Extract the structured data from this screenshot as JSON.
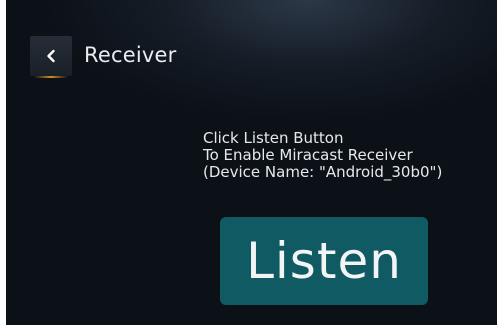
{
  "header": {
    "back_icon": "chevron-left-icon",
    "title": "Receiver"
  },
  "instructions": {
    "line1": "Click Listen Button",
    "line2": "To Enable Miracast Receiver",
    "line3": "(Device Name: \"Android_30b0\")"
  },
  "listen_button": {
    "label": "Listen"
  },
  "colors": {
    "background": "#151c26",
    "accent_underline": "#d98a26",
    "listen_button_bg": "#0f5a63",
    "text": "#e9ecef"
  }
}
